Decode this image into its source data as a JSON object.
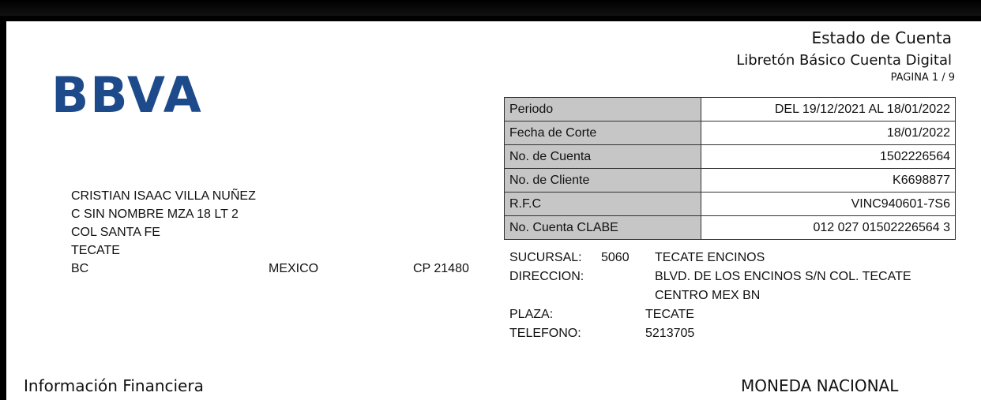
{
  "header": {
    "brand": "BBVA",
    "title": "Estado de Cuenta",
    "subtitle": "Libretón Básico Cuenta Digital",
    "page_label": "PAGINA",
    "page_value": "1 / 9"
  },
  "account_info": [
    {
      "label": "Periodo",
      "value": "DEL 19/12/2021 AL 18/01/2022"
    },
    {
      "label": "Fecha de Corte",
      "value": "18/01/2022"
    },
    {
      "label": "No. de Cuenta",
      "value": "1502226564"
    },
    {
      "label": "No. de Cliente",
      "value": "K6698877"
    },
    {
      "label": "R.F.C",
      "value": "VINC940601-7S6"
    },
    {
      "label": "No. Cuenta CLABE",
      "value": "012 027 01502226564 3"
    }
  ],
  "client": {
    "name": "CRISTIAN ISAAC VILLA NUÑEZ",
    "street": "C SIN NOMBRE MZA 18 LT 2",
    "colony": "COL SANTA FE",
    "city": "TECATE",
    "state": "BC",
    "country": "MEXICO",
    "cp": "CP  21480"
  },
  "branch": {
    "sucursal_label": "SUCURSAL:",
    "sucursal_code": "5060",
    "sucursal_name": "TECATE ENCINOS",
    "direccion_label": "DIRECCION:",
    "direccion_line1": "BLVD. DE LOS ENCINOS S/N COL. TECATE",
    "direccion_line2": "CENTRO MEX BN",
    "plaza_label": "PLAZA:",
    "plaza_value": "TECATE",
    "telefono_label": "TELEFONO:",
    "telefono_value": "5213705"
  },
  "sections": {
    "left": "Información Financiera",
    "right": "MONEDA NACIONAL"
  },
  "colors": {
    "brand_blue": "#1c4a8a",
    "label_bg": "#c6c6c6"
  }
}
